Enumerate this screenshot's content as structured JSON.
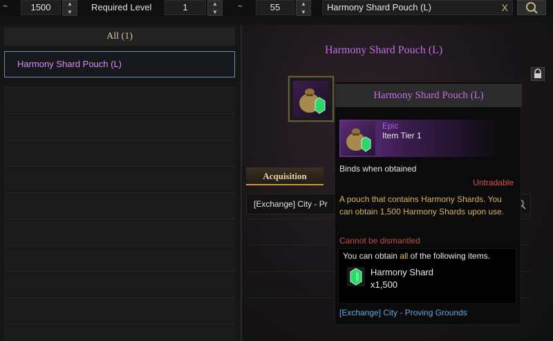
{
  "filters": {
    "tilde_symbol": "~",
    "min_value": "1500",
    "required_level_label": "Required Level",
    "level_min": "1",
    "level_max": "55",
    "search_value": "Harmony Shard Pouch (L)",
    "clear_symbol": "X"
  },
  "list": {
    "tab_label": "All (1)",
    "items": [
      {
        "label": "Harmony Shard Pouch (L)"
      }
    ]
  },
  "detail": {
    "title": "Harmony Shard Pouch (L)",
    "acquisition_tab": "Acquisition",
    "acquisition_row": "[Exchange] City - Pr"
  },
  "tooltip": {
    "name": "Harmony Shard Pouch (L)",
    "rarity": "Epic",
    "tier": "Item Tier 1",
    "binds": "Binds when obtained",
    "trade": "Untradable",
    "description": "A pouch that contains Harmony Shards. You can obtain 1,500 Harmony Shards upon use.",
    "dismantle": "Cannot be dismantled",
    "obtain_prefix": "You can obtain ",
    "obtain_highlight": "all",
    "obtain_suffix": " of the following items.",
    "reward_name": "Harmony Shard",
    "reward_qty": "x1,500",
    "source": "[Exchange] City - Proving Grounds"
  },
  "colors": {
    "epic": "#c76ae8",
    "untradable": "#d65454",
    "description": "#d6b566",
    "source_link": "#5fa8e6"
  },
  "icons": [
    "chevron-up-icon",
    "chevron-down-icon",
    "search-icon",
    "close-icon",
    "lock-icon",
    "pouch-icon",
    "shard-icon"
  ]
}
